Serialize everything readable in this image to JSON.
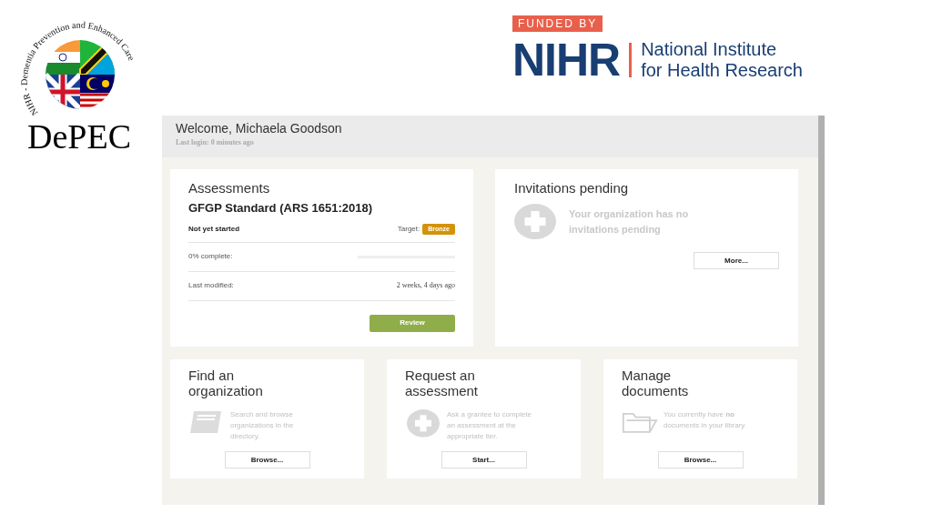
{
  "logo": {
    "ring_text": "NIHR - Dementia Prevention and Enhanced Care",
    "wordmark": "DePEC"
  },
  "funder": {
    "badge": "FUNDED BY",
    "acronym": "NIHR",
    "name_lines": [
      "National Institute",
      "for Health Research"
    ]
  },
  "app": {
    "welcome": "Welcome, Michaela Goodson",
    "last_login": "Last login: 0 minutes ago",
    "assessments": {
      "title": "Assessments",
      "standard": "GFGP Standard (ARS 1651:2018)",
      "status": "Not yet started",
      "target_label": "Target:",
      "target": "Bronze",
      "progress_label": "0% complete:",
      "level": 0,
      "modified_label": "Last modified:",
      "modified_value": "2 weeks, 4 days ago",
      "button": "Review"
    },
    "invitations": {
      "title": "Invitations pending",
      "message": "Your organization has no invitations pending",
      "button": "More..."
    },
    "tiles": [
      {
        "kind": "book",
        "title_lines": [
          "Find an",
          "organization"
        ],
        "description": "Search and browse organizations in the directory.",
        "button": "Browse..."
      },
      {
        "kind": "plus",
        "title_lines": [
          "Request an",
          "assessment"
        ],
        "description": "Ask a grantee to complete an assessment at the appropriate tier.",
        "button": "Start..."
      },
      {
        "kind": "folder",
        "title_lines": [
          "Manage",
          "documents"
        ],
        "description": "You currently have **no** documents in your library.",
        "button": "Browse..."
      }
    ]
  }
}
